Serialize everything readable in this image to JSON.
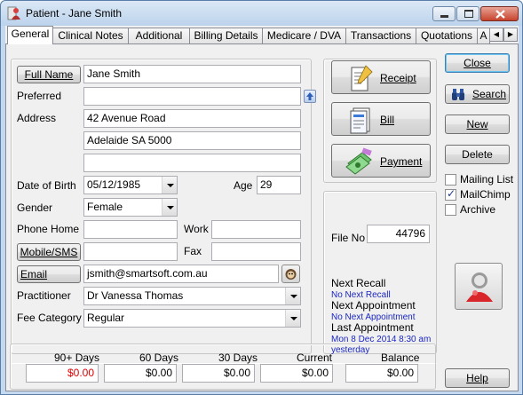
{
  "window": {
    "title": "Patient - Jane Smith"
  },
  "tabs": [
    {
      "label": "General",
      "active": true
    },
    {
      "label": "Clinical Notes"
    },
    {
      "label": "Additional"
    },
    {
      "label": "Billing Details"
    },
    {
      "label": "Medicare / DVA"
    },
    {
      "label": "Transactions"
    },
    {
      "label": "Quotations"
    },
    {
      "label": "A"
    }
  ],
  "form": {
    "full_name_label": "Full Name",
    "full_name": "Jane Smith",
    "preferred_label": "Preferred",
    "preferred": "",
    "address_label": "Address",
    "address_line1": "42 Avenue Road",
    "address_line2": "Adelaide  SA  5000",
    "address_line3": "",
    "dob_label": "Date of Birth",
    "dob": "05/12/1985",
    "age_label": "Age",
    "age": "29",
    "gender_label": "Gender",
    "gender": "Female",
    "phone_home_label": "Phone Home",
    "phone_home": "",
    "work_label": "Work",
    "work": "",
    "mobile_label": "Mobile/SMS",
    "mobile": "",
    "fax_label": "Fax",
    "fax": "",
    "email_label": "Email",
    "email": "jsmith@smartsoft.com.au",
    "practitioner_label": "Practitioner",
    "practitioner": "Dr Vanessa Thomas",
    "fee_category_label": "Fee Category",
    "fee_category": "Regular"
  },
  "actions": {
    "receipt": "Receipt",
    "bill": "Bill",
    "payment": "Payment"
  },
  "info": {
    "file_no_label": "File No",
    "file_no": "44796",
    "next_recall_label": "Next Recall",
    "next_recall": "No Next Recall",
    "next_appointment_label": "Next Appointment",
    "next_appointment": "No Next Appointment",
    "last_appointment_label": "Last Appointment",
    "last_appointment": "Mon 8 Dec 2014 8:30 am",
    "last_appointment_rel": "yesterday"
  },
  "side": {
    "close": "Close",
    "search": "Search",
    "new": "New",
    "delete": "Delete",
    "help": "Help",
    "mailing_list": "Mailing List",
    "mailing_list_checked": false,
    "mailchimp": "MailChimp",
    "mailchimp_checked": true,
    "archive": "Archive",
    "archive_checked": false
  },
  "balances": [
    {
      "label": "90+ Days",
      "value": "$0.00",
      "color": "#e00000"
    },
    {
      "label": "60 Days",
      "value": "$0.00"
    },
    {
      "label": "30 Days",
      "value": "$0.00"
    },
    {
      "label": "Current",
      "value": "$0.00"
    },
    {
      "label": "Balance",
      "value": "$0.00"
    }
  ]
}
